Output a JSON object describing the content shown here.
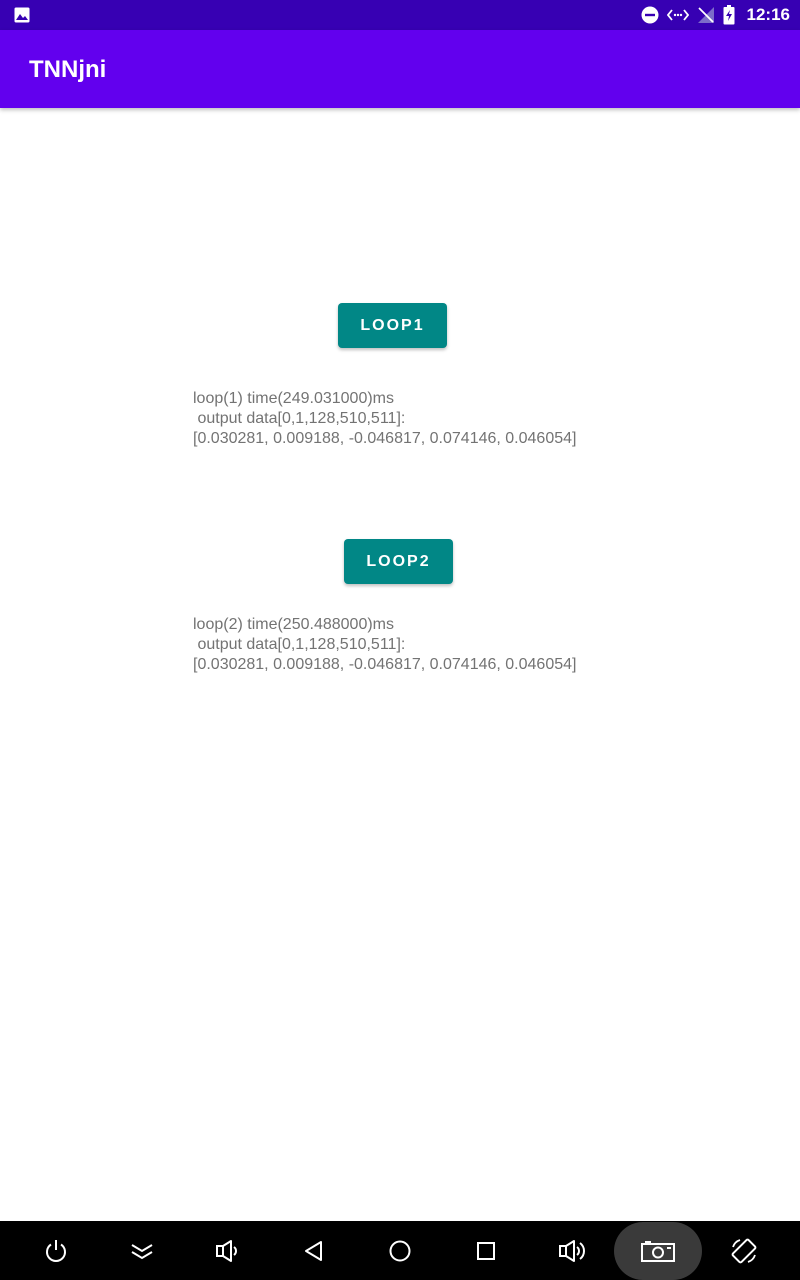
{
  "status_bar": {
    "time": "12:16",
    "icons": [
      "image-icon",
      "do-not-disturb-icon",
      "data-sync-icon",
      "no-signal-icon",
      "battery-charging-icon"
    ]
  },
  "app_bar": {
    "title": "TNNjni"
  },
  "main": {
    "loop1": {
      "button_label": "LOOP1",
      "output": "loop(1) time(249.031000)ms\n output data[0,1,128,510,511]:\n[0.030281, 0.009188, -0.046817, 0.074146, 0.046054]"
    },
    "loop2": {
      "button_label": "LOOP2",
      "output": "loop(2) time(250.488000)ms\n output data[0,1,128,510,511]:\n[0.030281, 0.009188, -0.046817, 0.074146, 0.046054]"
    }
  },
  "nav_bar": {
    "items": [
      "power-icon",
      "collapse-icon",
      "volume-down-icon",
      "back-icon",
      "home-icon",
      "recents-icon",
      "volume-up-icon",
      "screenshot-icon",
      "rotate-icon"
    ]
  },
  "colors": {
    "status_bar": "#3700b3",
    "app_bar": "#6200ee",
    "button": "#018786",
    "output_text": "#737373",
    "nav_bar": "#000000"
  }
}
